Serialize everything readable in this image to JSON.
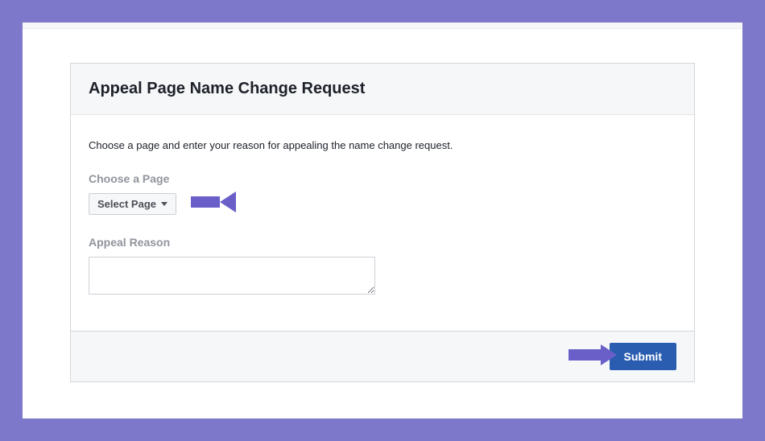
{
  "header": {
    "title": "Appeal Page Name Change Request"
  },
  "body": {
    "description": "Choose a page and enter your reason for appealing the name change request.",
    "choosePage": {
      "label": "Choose a Page",
      "buttonText": "Select Page"
    },
    "appealReason": {
      "label": "Appeal Reason",
      "value": ""
    }
  },
  "footer": {
    "submitText": "Submit"
  },
  "colors": {
    "annotation": "#6a5fc9",
    "frame": "#7e78ca",
    "primaryButton": "#2a5db0"
  }
}
